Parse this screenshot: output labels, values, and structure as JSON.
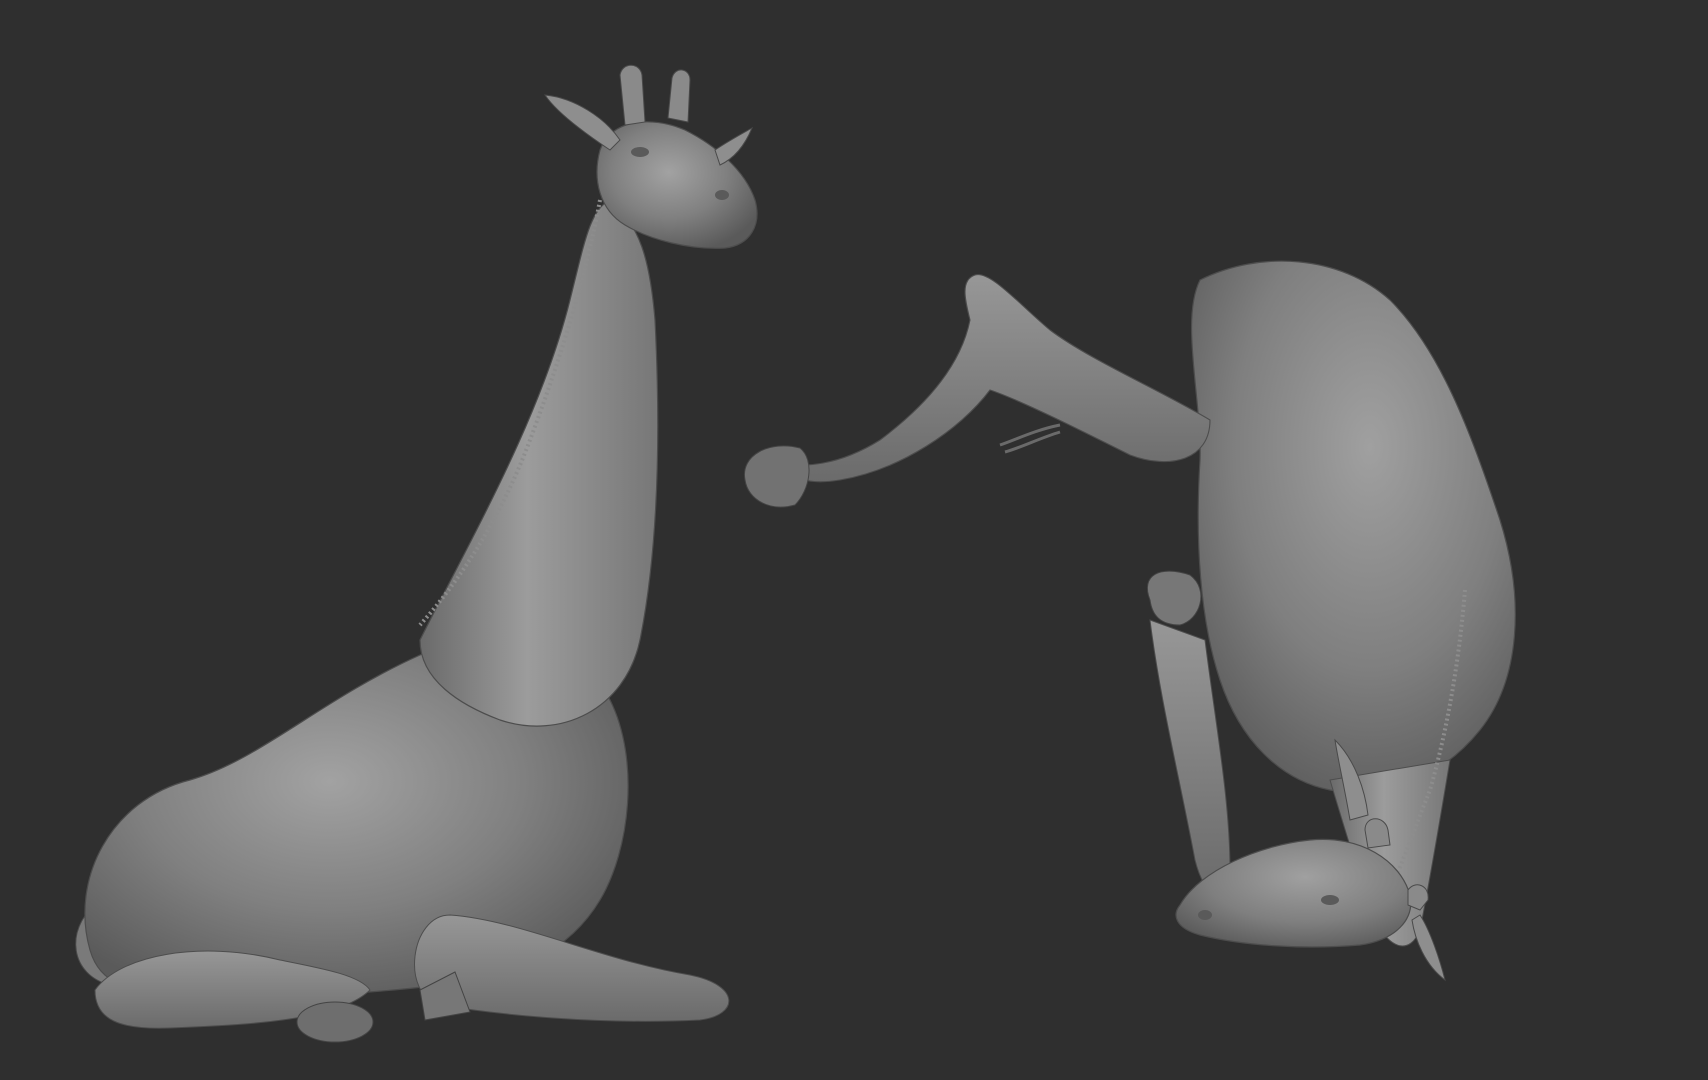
{
  "viewport": {
    "background": "#2f2f2f"
  },
  "models": [
    {
      "name": "seated-giraffe-sculpt",
      "orientation": "upright",
      "material": "grey-clay"
    },
    {
      "name": "inverted-giraffe-sculpt",
      "orientation": "upside-down",
      "material": "grey-clay"
    }
  ],
  "colors": {
    "clay_light": "#9a9a9a",
    "clay_mid": "#7a7a7a",
    "clay_dark": "#555555",
    "clay_shadow": "#3e3e3e"
  }
}
